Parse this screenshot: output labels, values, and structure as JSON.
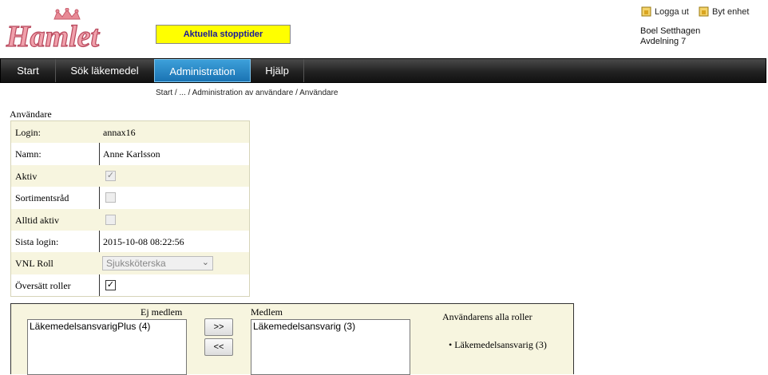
{
  "header": {
    "logo_text": "Hamlet",
    "stop_button": "Aktuella stopptider",
    "logout": "Logga ut",
    "switch_unit": "Byt enhet",
    "user_name": "Boel Setthagen",
    "unit": "Avdelning 7"
  },
  "nav": {
    "items": [
      "Start",
      "Sök läkemedel",
      "Administration",
      "Hjälp"
    ],
    "active": "Administration"
  },
  "breadcrumb": "Start / ... / Administration av användare / Användare",
  "user": {
    "section_title": "Användare",
    "fields": [
      {
        "label": "Login:",
        "value": "annax16"
      },
      {
        "label": "Namn:",
        "value": "Anne Karlsson"
      },
      {
        "label": "Aktiv",
        "checked": true,
        "enabled": false
      },
      {
        "label": "Sortimentsråd",
        "checked": false,
        "enabled": false
      },
      {
        "label": "Alltid aktiv",
        "checked": false,
        "enabled": false
      },
      {
        "label": "Sista login:",
        "value": "2015-10-08 08:22:56"
      },
      {
        "label": "VNL Roll",
        "select": "Sjuksköterska"
      },
      {
        "label": "Översätt roller",
        "checked": true,
        "enabled": true
      }
    ]
  },
  "roles": {
    "not_member_label": "Ej medlem",
    "member_label": "Medlem",
    "all_roles_label": "Användarens alla roller",
    "not_member_items": [
      "LäkemedelsansvarigPlus (4)"
    ],
    "member_items": [
      "Läkemedelsansvarig (3)"
    ],
    "add_button": ">>",
    "remove_button": "<<",
    "all_roles": [
      "Läkemedelsansvarig (3)"
    ]
  }
}
